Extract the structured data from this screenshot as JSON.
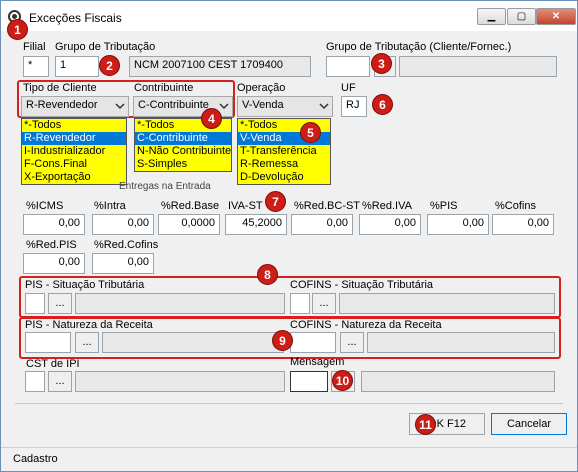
{
  "window": {
    "title": "Exceções Fiscais",
    "min": "▁",
    "max": "▢",
    "close": "✕"
  },
  "filial": {
    "label": "Filial",
    "value": "*"
  },
  "grupo_trib": {
    "label": "Grupo de Tributação",
    "code": "1",
    "desc": "NCM 2007100 CEST 1709400"
  },
  "grupo_trib_cli": {
    "label": "Grupo de Tributação (Cliente/Fornec.)",
    "code": "",
    "desc": ""
  },
  "tipo_cliente": {
    "label": "Tipo de Cliente",
    "value": "R-Revendedor",
    "options": [
      "*-Todos",
      "R-Revendedor",
      "I-Industrializador",
      "F-Cons.Final",
      "X-Exportação"
    ],
    "selected_index": 1
  },
  "contribuinte": {
    "label": "Contribuinte",
    "value": "C-Contribuinte",
    "options": [
      "*-Todos",
      "C-Contribuinte",
      "N-Não Contribuinte",
      "S-Simples"
    ],
    "selected_index": 1
  },
  "operacao": {
    "label": "Operação",
    "value": "V-Venda",
    "options": [
      "*-Todos",
      "V-Venda",
      "T-Transferência",
      "R-Remessa",
      "D-Devolução"
    ],
    "selected_index": 1
  },
  "uf": {
    "label": "UF",
    "value": "RJ"
  },
  "tabs_partial": "Entregas na Entrada",
  "percentuais": [
    {
      "label": "%ICMS",
      "value": "0,00"
    },
    {
      "label": "%Intra",
      "value": "0,00"
    },
    {
      "label": "%Red.Base",
      "value": "0,0000"
    },
    {
      "label": "IVA-ST",
      "value": "45,2000"
    },
    {
      "label": "%Red.BC-ST",
      "value": "0,00"
    },
    {
      "label": "%Red.IVA",
      "value": "0,00"
    },
    {
      "label": "%PIS",
      "value": "0,00"
    },
    {
      "label": "%Cofins",
      "value": "0,00"
    },
    {
      "label": "%Red.PIS",
      "value": "0,00"
    },
    {
      "label": "%Red.Cofins",
      "value": "0,00"
    }
  ],
  "pis_sit": {
    "label": "PIS - Situação Tributária",
    "btn": "..."
  },
  "cofins_sit": {
    "label": "COFINS - Situação Tributária",
    "btn": "..."
  },
  "pis_nat": {
    "label": "PIS - Natureza da Receita",
    "btn": "..."
  },
  "cofins_nat": {
    "label": "COFINS - Natureza da Receita",
    "btn": "..."
  },
  "cst_ipi": {
    "label": "CST de IPI",
    "btn": "..."
  },
  "mensagem": {
    "label": "Mensagem"
  },
  "buttons": {
    "ok": "OK F12",
    "cancel": "Cancelar"
  },
  "status": {
    "tab": "Cadastro"
  },
  "badges": [
    "1",
    "2",
    "3",
    "4",
    "5",
    "6",
    "7",
    "8",
    "9",
    "10",
    "11"
  ],
  "colors": {
    "badge": "#cc1d17",
    "highlight_box": "#d61f1f",
    "dropdown_bg": "#ffff00",
    "selection": "#0078d7"
  }
}
